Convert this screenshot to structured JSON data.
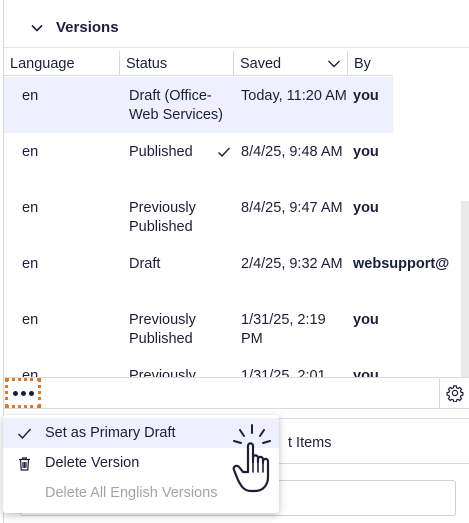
{
  "section": {
    "title": "Versions"
  },
  "table": {
    "columns": [
      "Language",
      "Status",
      "Saved",
      "By"
    ],
    "rows": [
      {
        "language": "en",
        "status": "Draft (Office-Web Services)",
        "saved": "Today, 11:20 AM",
        "by": "you",
        "selected": true
      },
      {
        "language": "en",
        "status": "Published",
        "saved": "8/4/25, 9:48 AM",
        "by": "you",
        "primary": true
      },
      {
        "language": "en",
        "status": "Previously Published",
        "saved": "8/4/25, 9:47 AM",
        "by": "you"
      },
      {
        "language": "en",
        "status": "Draft",
        "saved": "2/4/25, 9:32 AM",
        "by": "websupport@"
      },
      {
        "language": "en",
        "status": "Previously Published",
        "saved": "1/31/25, 2:19 PM",
        "by": "you"
      },
      {
        "language": "en",
        "status": "Previously",
        "saved": "1/31/25, 2:01",
        "by": "you"
      }
    ]
  },
  "toolbar": {
    "more_icon": "ellipsis-icon",
    "settings_icon": "gear-icon"
  },
  "behind": {
    "tab_label": "t Items"
  },
  "menu": {
    "items": [
      {
        "label": "Set as Primary Draft",
        "icon": "check-icon",
        "enabled": true
      },
      {
        "label": "Delete Version",
        "icon": "trash-icon",
        "enabled": true
      },
      {
        "label": "Delete All English Versions",
        "icon": "",
        "enabled": false
      }
    ]
  },
  "colors": {
    "accent_outline": "#e0782a",
    "selected_row": "#eef0fd",
    "text": "#1b1f3b",
    "disabled": "#a4a4a4"
  }
}
